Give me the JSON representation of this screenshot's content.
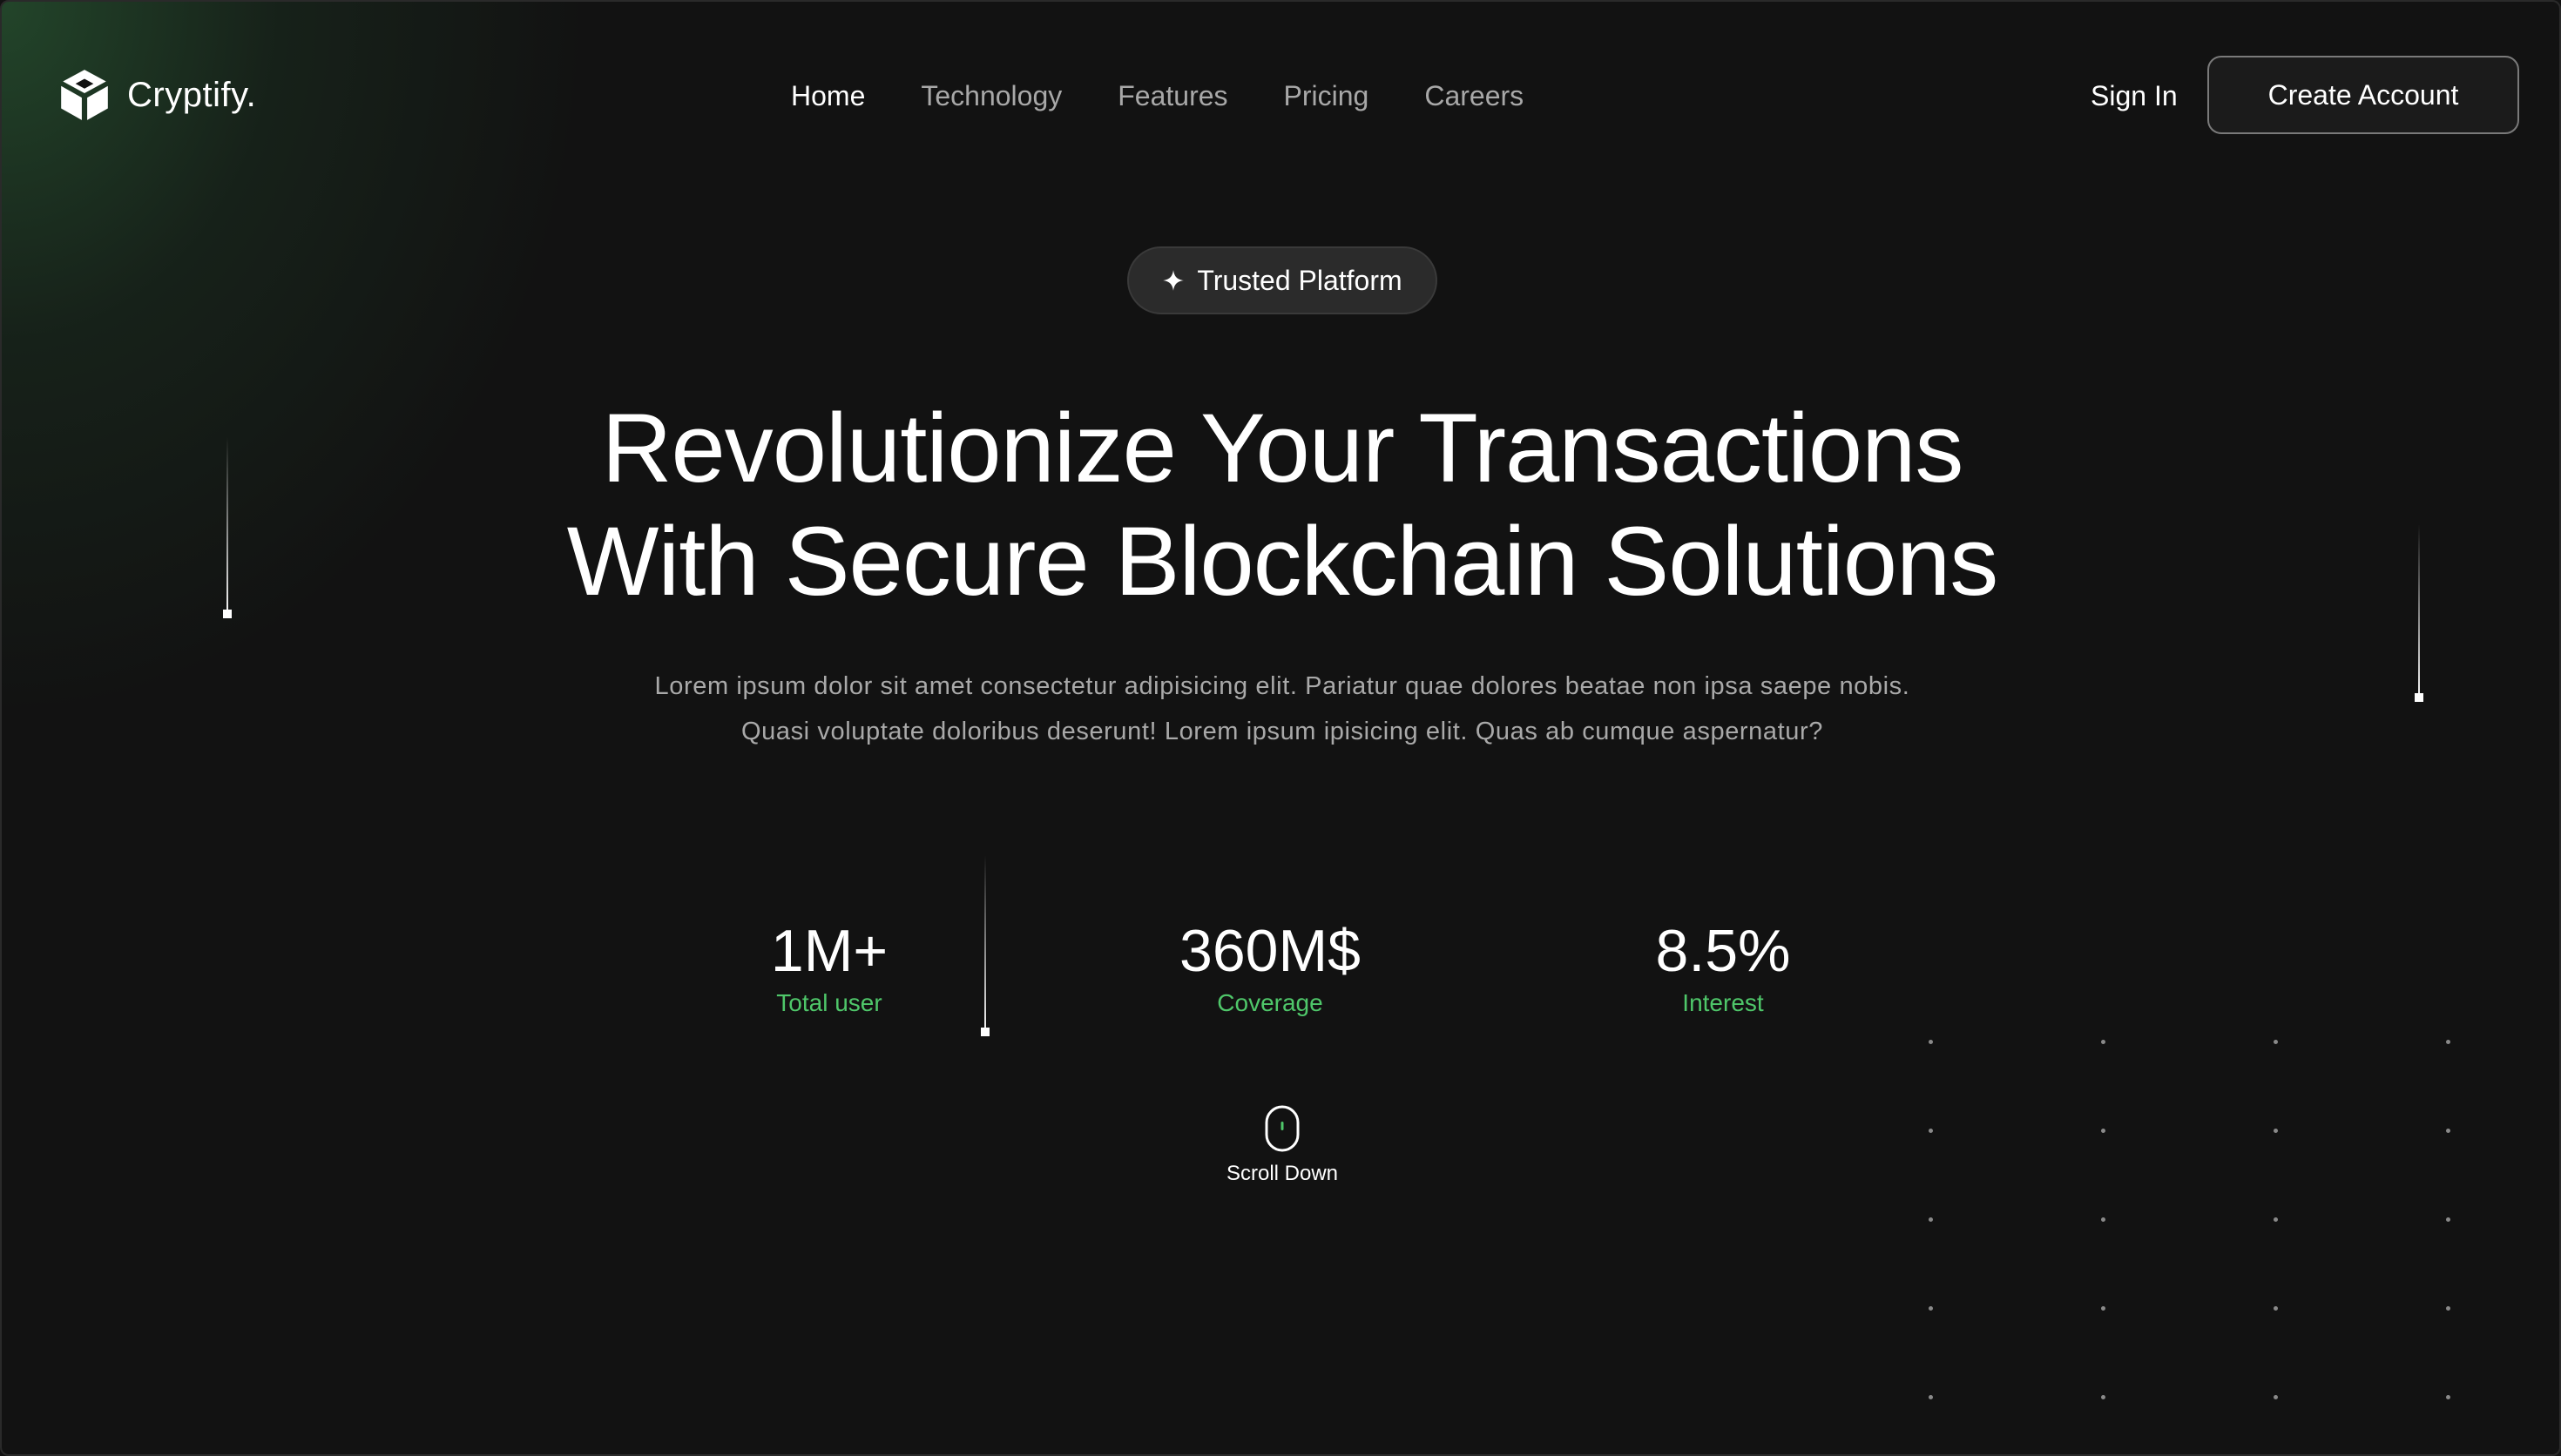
{
  "brand": {
    "name": "Cryptify.",
    "logo_icon": "cube-logo-icon"
  },
  "nav": {
    "items": [
      {
        "label": "Home",
        "active": true
      },
      {
        "label": "Technology",
        "active": false
      },
      {
        "label": "Features",
        "active": false
      },
      {
        "label": "Pricing",
        "active": false
      },
      {
        "label": "Careers",
        "active": false
      }
    ]
  },
  "auth": {
    "signin_label": "Sign In",
    "create_account_label": "Create Account"
  },
  "badge": {
    "icon": "sparkle-icon",
    "label": "Trusted Platform"
  },
  "hero": {
    "headline_line1": "Revolutionize Your Transactions",
    "headline_line2": "With Secure Blockchain Solutions",
    "subtext": "Lorem ipsum dolor sit amet consectetur adipisicing elit. Pariatur quae dolores beatae non ipsa saepe nobis. Quasi voluptate doloribus deserunt! Lorem ipsum ipisicing elit. Quas ab cumque aspernatur?"
  },
  "stats": [
    {
      "value": "1M+",
      "label": "Total user"
    },
    {
      "value": "360M$",
      "label": "Coverage"
    },
    {
      "value": "8.5%",
      "label": "Interest"
    }
  ],
  "scroll": {
    "icon": "mouse-icon",
    "label": "Scroll Down"
  },
  "colors": {
    "background": "#121212",
    "accent_green": "#4fc76a",
    "muted_text": "#a9a9a9",
    "glow_green": "#285632"
  }
}
